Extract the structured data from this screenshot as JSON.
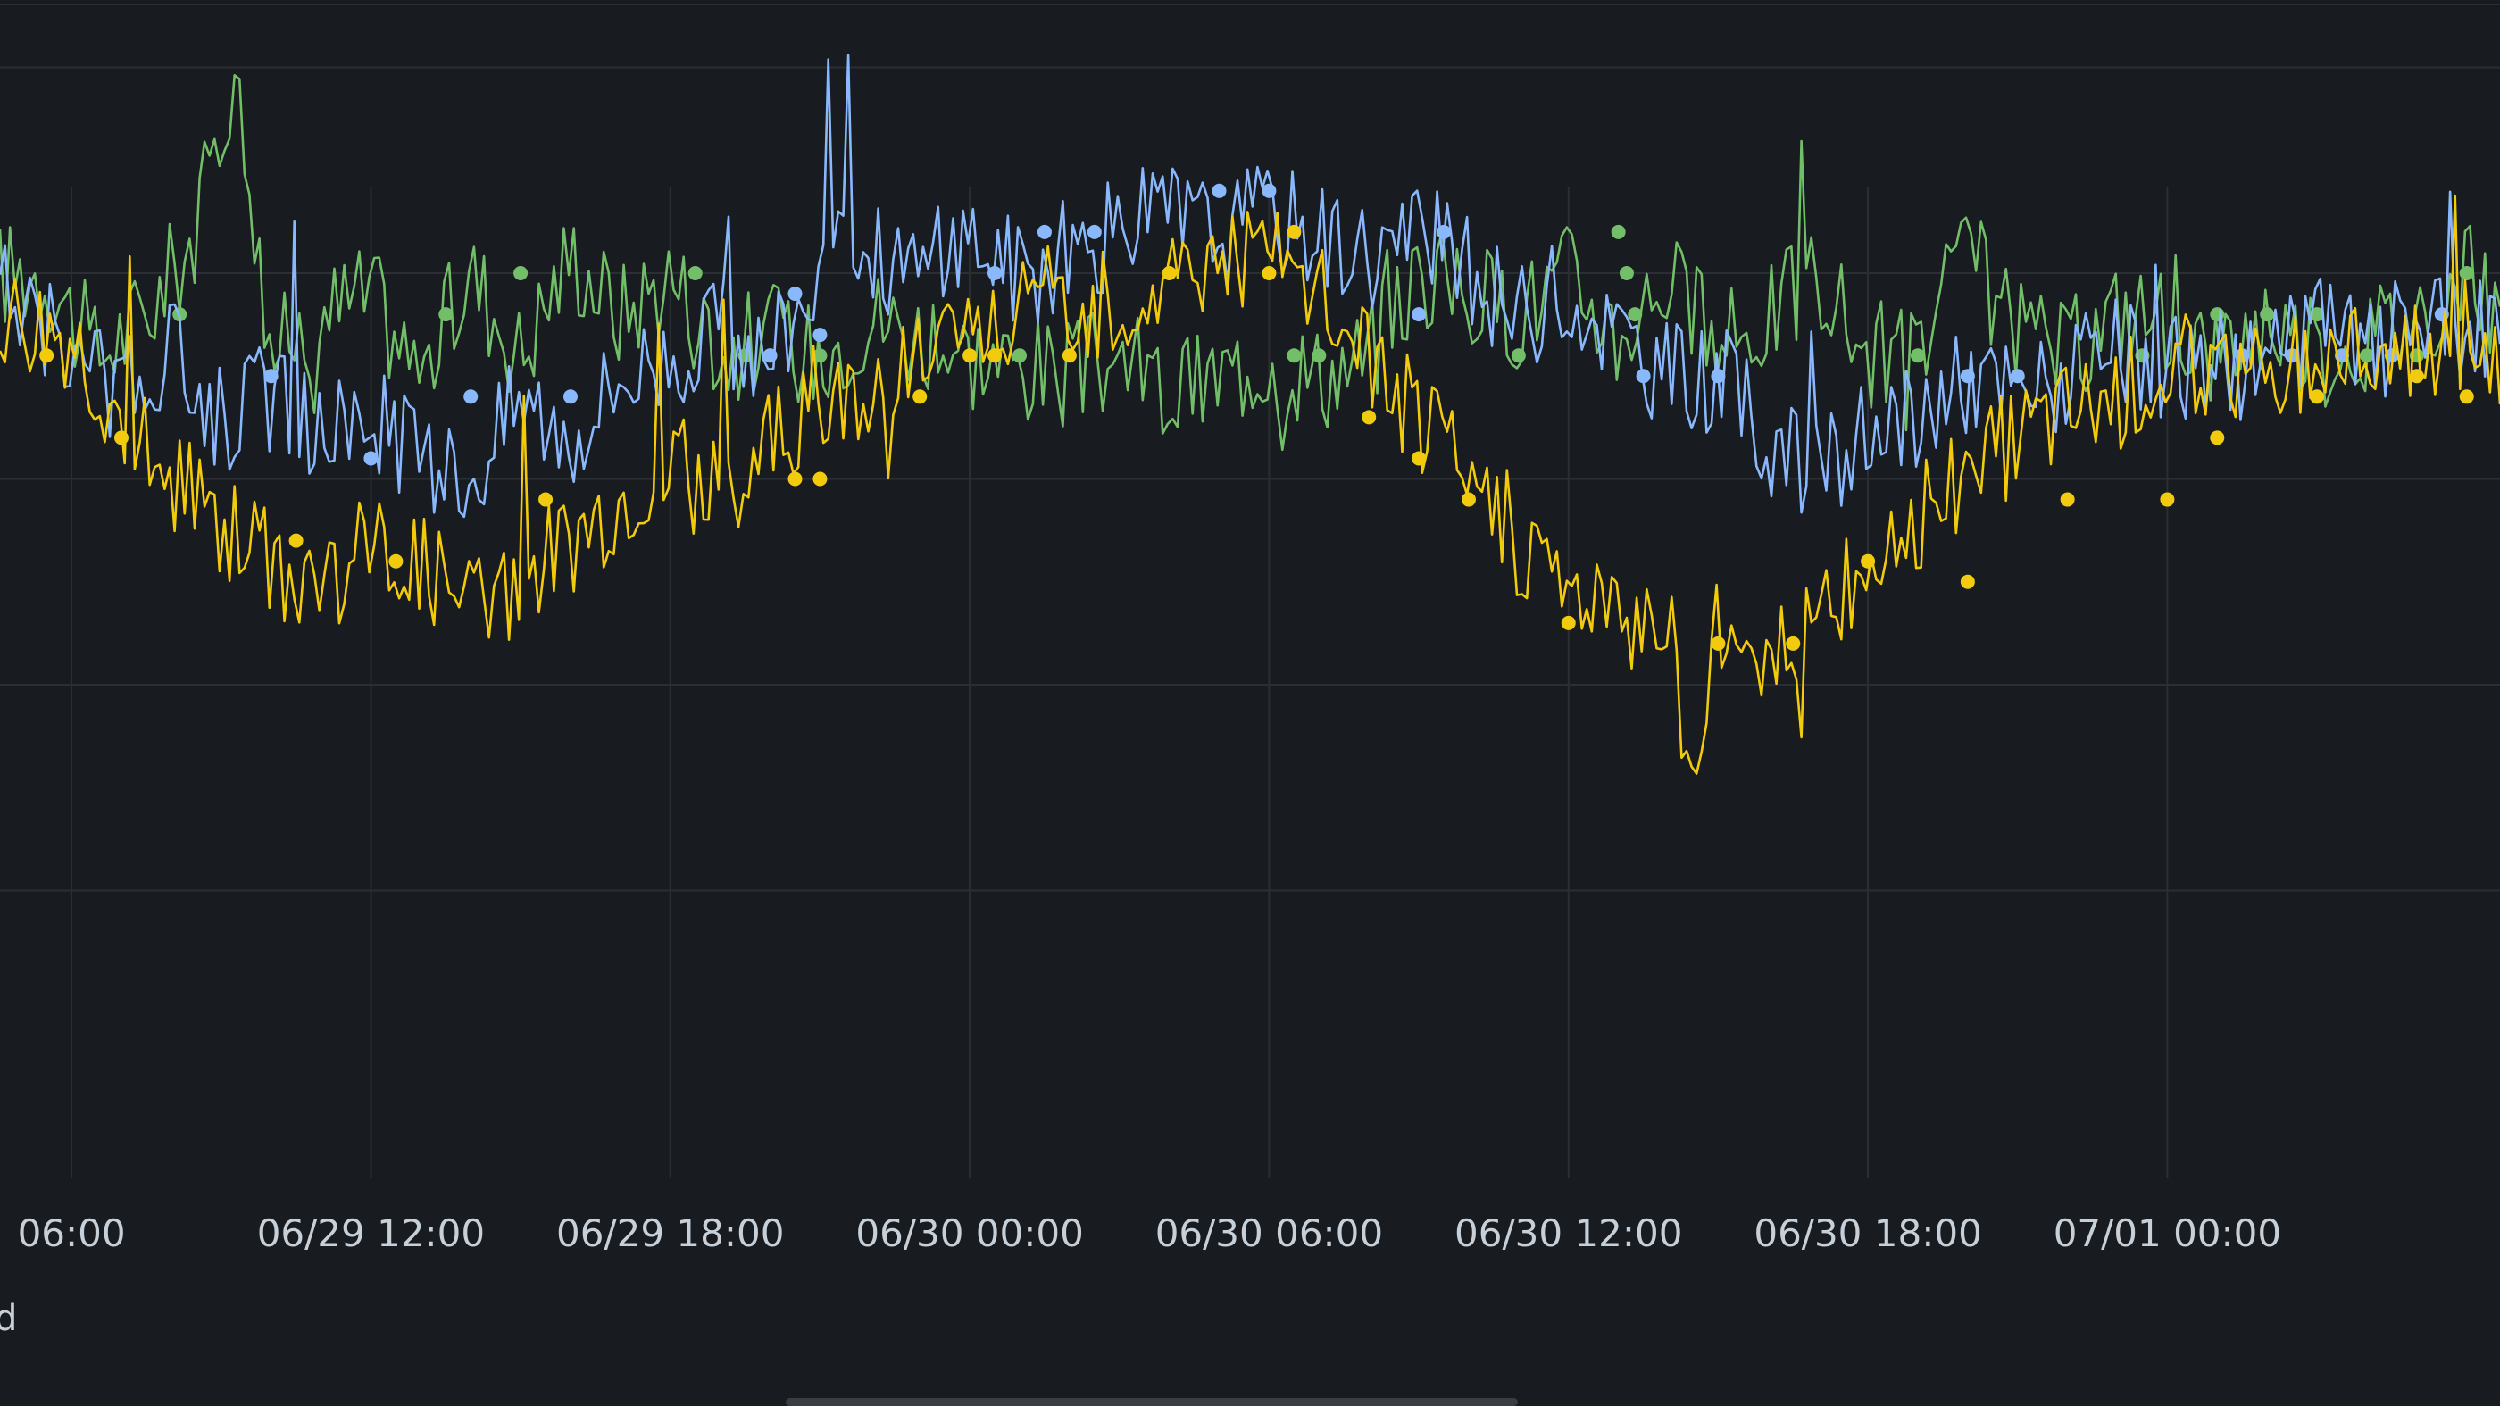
{
  "panel": {
    "legend_fragment": "d"
  },
  "chart_data": {
    "type": "line",
    "x_axis": {
      "type": "time",
      "range": [
        "2024-06-29 04:34",
        "2024-07-01 06:40"
      ],
      "ticks": [
        "2024-06-29 06:00",
        "2024-06-29 12:00",
        "2024-06-29 18:00",
        "2024-06-30 00:00",
        "2024-06-30 06:00",
        "2024-06-30 12:00",
        "2024-06-30 18:00",
        "2024-07-01 00:00"
      ],
      "tick_labels": [
        "06:00",
        "06/29 12:00",
        "06/29 18:00",
        "06/30 00:00",
        "06/30 06:00",
        "06/30 12:00",
        "06/30 18:00",
        "07/01 00:00"
      ]
    },
    "y_axis": {
      "range": [
        0,
        5.6
      ],
      "grid_values": [
        1,
        2,
        3,
        4,
        5
      ],
      "tick_labels": []
    },
    "grid": true,
    "series": [
      {
        "color": "#73bf69",
        "style": "line+points",
        "points": [
          [
            "2024-06-29 04:34",
            4.0
          ],
          [
            "2024-06-29 05:30",
            4.0
          ],
          [
            "2024-06-29 06:30",
            3.6
          ],
          [
            "2024-06-29 07:30",
            3.8
          ],
          [
            "2024-06-29 08:30",
            4.2
          ],
          [
            "2024-06-29 09:15",
            5.0
          ],
          [
            "2024-06-29 10:00",
            3.6
          ],
          [
            "2024-06-29 11:00",
            3.8
          ],
          [
            "2024-06-29 12:00",
            3.9
          ],
          [
            "2024-06-29 13:00",
            3.5
          ],
          [
            "2024-06-29 14:00",
            4.0
          ],
          [
            "2024-06-29 15:00",
            3.6
          ],
          [
            "2024-06-29 16:00",
            4.1
          ],
          [
            "2024-06-29 17:00",
            3.8
          ],
          [
            "2024-06-29 18:00",
            4.0
          ],
          [
            "2024-06-29 19:00",
            3.6
          ],
          [
            "2024-06-29 20:00",
            3.7
          ],
          [
            "2024-06-29 21:00",
            3.6
          ],
          [
            "2024-06-29 22:00",
            3.8
          ],
          [
            "2024-06-30 00:00",
            3.6
          ],
          [
            "2024-06-30 02:00",
            3.5
          ],
          [
            "2024-06-30 03:00",
            3.6
          ],
          [
            "2024-06-30 04:00",
            3.4
          ],
          [
            "2024-06-30 05:00",
            3.5
          ],
          [
            "2024-06-30 06:00",
            3.6
          ],
          [
            "2024-06-30 07:00",
            3.5
          ],
          [
            "2024-06-30 08:00",
            3.6
          ],
          [
            "2024-06-30 09:00",
            4.0
          ],
          [
            "2024-06-30 10:00",
            3.9
          ],
          [
            "2024-06-30 11:00",
            3.8
          ],
          [
            "2024-06-30 12:00",
            4.0
          ],
          [
            "2024-06-30 13:00",
            3.7
          ],
          [
            "2024-06-30 14:00",
            4.0
          ],
          [
            "2024-06-30 15:00",
            3.6
          ],
          [
            "2024-06-30 16:00",
            3.8
          ],
          [
            "2024-06-30 17:00",
            4.0
          ],
          [
            "2024-06-30 18:00",
            3.6
          ],
          [
            "2024-06-30 19:00",
            3.6
          ],
          [
            "2024-06-30 20:00",
            4.1
          ],
          [
            "2024-06-30 21:00",
            3.7
          ],
          [
            "2024-06-30 22:00",
            3.6
          ],
          [
            "2024-06-30 23:00",
            3.8
          ],
          [
            "2024-07-01 00:00",
            3.8
          ],
          [
            "2024-07-01 01:00",
            3.6
          ],
          [
            "2024-07-01 02:00",
            3.8
          ],
          [
            "2024-07-01 03:00",
            3.6
          ],
          [
            "2024-07-01 04:00",
            3.7
          ],
          [
            "2024-07-01 05:00",
            3.8
          ],
          [
            "2024-07-01 06:00",
            4.0
          ],
          [
            "2024-07-01 06:40",
            3.8
          ]
        ],
        "markers": [
          [
            "2024-06-29 08:10",
            3.8
          ],
          [
            "2024-06-29 13:30",
            3.8
          ],
          [
            "2024-06-29 15:00",
            4.0
          ],
          [
            "2024-06-29 18:30",
            4.0
          ],
          [
            "2024-06-29 19:30",
            3.6
          ],
          [
            "2024-06-29 20:00",
            3.6
          ],
          [
            "2024-06-29 21:00",
            3.6
          ],
          [
            "2024-06-30 01:00",
            3.6
          ],
          [
            "2024-06-30 06:30",
            3.6
          ],
          [
            "2024-06-30 07:00",
            3.6
          ],
          [
            "2024-06-30 11:00",
            3.6
          ],
          [
            "2024-06-30 13:00",
            4.2
          ],
          [
            "2024-06-30 13:10",
            4.0
          ],
          [
            "2024-06-30 13:20",
            3.8
          ],
          [
            "2024-06-30 19:00",
            3.6
          ],
          [
            "2024-06-30 23:30",
            3.6
          ],
          [
            "2024-07-01 01:00",
            3.8
          ],
          [
            "2024-07-01 02:00",
            3.8
          ],
          [
            "2024-07-01 03:00",
            3.8
          ],
          [
            "2024-07-01 04:00",
            3.6
          ],
          [
            "2024-07-01 05:00",
            3.6
          ],
          [
            "2024-07-01 06:00",
            4.0
          ]
        ]
      },
      {
        "color": "#8ab8ff",
        "style": "line+points",
        "points": [
          [
            "2024-06-29 04:34",
            3.9
          ],
          [
            "2024-06-29 06:00",
            3.6
          ],
          [
            "2024-06-29 07:00",
            3.4
          ],
          [
            "2024-06-29 08:00",
            3.6
          ],
          [
            "2024-06-29 09:00",
            3.3
          ],
          [
            "2024-06-29 10:00",
            3.4
          ],
          [
            "2024-06-29 11:00",
            3.2
          ],
          [
            "2024-06-29 12:00",
            3.3
          ],
          [
            "2024-06-29 13:00",
            3.1
          ],
          [
            "2024-06-29 14:00",
            3.0
          ],
          [
            "2024-06-29 15:00",
            3.4
          ],
          [
            "2024-06-29 16:00",
            3.2
          ],
          [
            "2024-06-29 17:00",
            3.5
          ],
          [
            "2024-06-29 18:00",
            3.6
          ],
          [
            "2024-06-29 19:00",
            3.7
          ],
          [
            "2024-06-29 20:00",
            3.6
          ],
          [
            "2024-06-29 21:00",
            4.0
          ],
          [
            "2024-06-29 22:00",
            4.1
          ],
          [
            "2024-06-29 23:00",
            4.0
          ],
          [
            "2024-06-30 00:00",
            4.2
          ],
          [
            "2024-06-30 01:00",
            4.0
          ],
          [
            "2024-06-30 02:00",
            4.1
          ],
          [
            "2024-06-30 03:00",
            4.2
          ],
          [
            "2024-06-30 04:00",
            4.3
          ],
          [
            "2024-06-30 05:00",
            4.2
          ],
          [
            "2024-06-30 06:00",
            4.3
          ],
          [
            "2024-06-30 07:00",
            4.2
          ],
          [
            "2024-06-30 08:00",
            4.1
          ],
          [
            "2024-06-30 09:00",
            4.2
          ],
          [
            "2024-06-30 10:00",
            4.0
          ],
          [
            "2024-06-30 11:00",
            3.8
          ],
          [
            "2024-06-30 12:00",
            3.9
          ],
          [
            "2024-06-30 13:00",
            3.7
          ],
          [
            "2024-06-30 14:00",
            3.5
          ],
          [
            "2024-06-30 15:00",
            3.5
          ],
          [
            "2024-06-30 16:00",
            3.2
          ],
          [
            "2024-06-30 17:00",
            3.0
          ],
          [
            "2024-06-30 18:00",
            3.2
          ],
          [
            "2024-06-30 19:00",
            3.3
          ],
          [
            "2024-06-30 20:00",
            3.5
          ],
          [
            "2024-06-30 21:00",
            3.4
          ],
          [
            "2024-06-30 22:00",
            3.5
          ],
          [
            "2024-06-30 23:00",
            3.6
          ],
          [
            "2024-07-01 00:00",
            3.5
          ],
          [
            "2024-07-01 01:00",
            3.6
          ],
          [
            "2024-07-01 02:00",
            3.5
          ],
          [
            "2024-07-01 03:00",
            3.8
          ],
          [
            "2024-07-01 04:00",
            3.6
          ],
          [
            "2024-07-01 05:00",
            3.8
          ],
          [
            "2024-07-01 06:00",
            3.7
          ],
          [
            "2024-07-01 06:40",
            3.8
          ]
        ],
        "markers": [
          [
            "2024-06-29 10:00",
            3.5
          ],
          [
            "2024-06-29 12:00",
            3.1
          ],
          [
            "2024-06-29 14:00",
            3.4
          ],
          [
            "2024-06-29 16:00",
            3.4
          ],
          [
            "2024-06-29 20:00",
            3.6
          ],
          [
            "2024-06-29 20:30",
            3.9
          ],
          [
            "2024-06-29 21:00",
            3.7
          ],
          [
            "2024-06-30 00:30",
            4.0
          ],
          [
            "2024-06-30 01:30",
            4.2
          ],
          [
            "2024-06-30 02:30",
            4.2
          ],
          [
            "2024-06-30 05:00",
            4.4
          ],
          [
            "2024-06-30 06:00",
            4.4
          ],
          [
            "2024-06-30 09:30",
            4.2
          ],
          [
            "2024-06-30 09:00",
            3.8
          ],
          [
            "2024-06-30 13:30",
            3.5
          ],
          [
            "2024-06-30 15:00",
            3.5
          ],
          [
            "2024-06-30 20:00",
            3.5
          ],
          [
            "2024-06-30 21:00",
            3.5
          ],
          [
            "2024-07-01 01:30",
            3.6
          ],
          [
            "2024-07-01 02:30",
            3.6
          ],
          [
            "2024-07-01 03:30",
            3.6
          ],
          [
            "2024-07-01 04:30",
            3.6
          ],
          [
            "2024-07-01 05:30",
            3.8
          ]
        ]
      },
      {
        "color": "#f2cc0c",
        "style": "line+points",
        "points": [
          [
            "2024-06-29 04:34",
            3.8
          ],
          [
            "2024-06-29 06:00",
            3.7
          ],
          [
            "2024-06-29 07:00",
            3.3
          ],
          [
            "2024-06-29 08:00",
            3.0
          ],
          [
            "2024-06-29 09:00",
            2.8
          ],
          [
            "2024-06-29 10:00",
            2.6
          ],
          [
            "2024-06-29 11:00",
            2.5
          ],
          [
            "2024-06-29 12:00",
            2.7
          ],
          [
            "2024-06-29 13:00",
            2.6
          ],
          [
            "2024-06-29 14:00",
            2.4
          ],
          [
            "2024-06-29 15:00",
            2.5
          ],
          [
            "2024-06-29 16:00",
            2.7
          ],
          [
            "2024-06-29 17:00",
            2.9
          ],
          [
            "2024-06-29 18:00",
            3.1
          ],
          [
            "2024-06-29 19:00",
            2.9
          ],
          [
            "2024-06-29 20:00",
            3.2
          ],
          [
            "2024-06-29 21:00",
            3.3
          ],
          [
            "2024-06-29 22:00",
            3.5
          ],
          [
            "2024-06-29 23:00",
            3.6
          ],
          [
            "2024-06-30 00:00",
            3.7
          ],
          [
            "2024-06-30 01:00",
            3.8
          ],
          [
            "2024-06-30 02:00",
            3.9
          ],
          [
            "2024-06-30 03:00",
            3.8
          ],
          [
            "2024-06-30 04:00",
            4.0
          ],
          [
            "2024-06-30 05:00",
            4.1
          ],
          [
            "2024-06-30 06:00",
            4.1
          ],
          [
            "2024-06-30 07:00",
            3.9
          ],
          [
            "2024-06-30 08:00",
            3.6
          ],
          [
            "2024-06-30 09:00",
            3.3
          ],
          [
            "2024-06-30 10:00",
            3.0
          ],
          [
            "2024-06-30 11:00",
            2.7
          ],
          [
            "2024-06-30 12:00",
            2.5
          ],
          [
            "2024-06-30 13:00",
            2.3
          ],
          [
            "2024-06-30 14:00",
            2.4
          ],
          [
            "2024-06-30 14:30",
            1.5
          ],
          [
            "2024-06-30 15:00",
            2.3
          ],
          [
            "2024-06-30 16:00",
            2.2
          ],
          [
            "2024-06-30 17:00",
            2.3
          ],
          [
            "2024-06-30 18:00",
            2.6
          ],
          [
            "2024-06-30 19:00",
            2.8
          ],
          [
            "2024-06-30 20:00",
            3.0
          ],
          [
            "2024-06-30 21:00",
            3.2
          ],
          [
            "2024-06-30 22:00",
            3.3
          ],
          [
            "2024-06-30 23:00",
            3.4
          ],
          [
            "2024-07-01 00:00",
            3.5
          ],
          [
            "2024-07-01 01:00",
            3.6
          ],
          [
            "2024-07-01 02:00",
            3.5
          ],
          [
            "2024-07-01 03:00",
            3.6
          ],
          [
            "2024-07-01 04:00",
            3.7
          ],
          [
            "2024-07-01 05:00",
            3.6
          ],
          [
            "2024-07-01 06:00",
            3.7
          ],
          [
            "2024-07-01 06:40",
            3.6
          ]
        ],
        "markers": [
          [
            "2024-06-29 05:30",
            3.6
          ],
          [
            "2024-06-29 07:00",
            3.2
          ],
          [
            "2024-06-29 10:30",
            2.7
          ],
          [
            "2024-06-29 12:30",
            2.6
          ],
          [
            "2024-06-29 15:30",
            2.9
          ],
          [
            "2024-06-29 20:30",
            3.0
          ],
          [
            "2024-06-29 21:00",
            3.0
          ],
          [
            "2024-06-29 23:00",
            3.4
          ],
          [
            "2024-06-30 00:00",
            3.6
          ],
          [
            "2024-06-30 00:30",
            3.6
          ],
          [
            "2024-06-30 02:00",
            3.6
          ],
          [
            "2024-06-30 04:00",
            4.0
          ],
          [
            "2024-06-30 06:00",
            4.0
          ],
          [
            "2024-06-30 06:30",
            4.2
          ],
          [
            "2024-06-30 08:00",
            3.3
          ],
          [
            "2024-06-30 09:00",
            3.1
          ],
          [
            "2024-06-30 10:00",
            2.9
          ],
          [
            "2024-06-30 12:00",
            2.3
          ],
          [
            "2024-06-30 15:00",
            2.2
          ],
          [
            "2024-06-30 16:30",
            2.2
          ],
          [
            "2024-06-30 18:00",
            2.6
          ],
          [
            "2024-06-30 20:00",
            2.5
          ],
          [
            "2024-06-30 22:00",
            2.9
          ],
          [
            "2024-07-01 00:00",
            2.9
          ],
          [
            "2024-07-01 01:00",
            3.2
          ],
          [
            "2024-07-01 03:00",
            3.4
          ],
          [
            "2024-07-01 05:00",
            3.5
          ],
          [
            "2024-07-01 06:00",
            3.4
          ]
        ]
      }
    ]
  }
}
